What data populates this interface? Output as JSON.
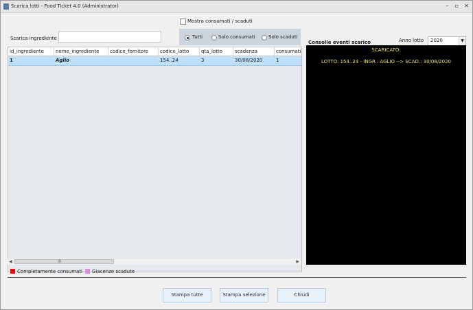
{
  "window": {
    "title": "Scarica lotti - Food Ticket 4.0   (Administrator)",
    "controls": [
      "–",
      "▫",
      "✕"
    ]
  },
  "filters": {
    "show_consumed_label": "Mostra consumati / scaduti",
    "show_consumed_checked": false,
    "search_label": "Scarica ingrediente",
    "search_value": "",
    "radio_options": [
      {
        "label": "Tutti",
        "selected": true
      },
      {
        "label": "Solo consumati",
        "selected": false
      },
      {
        "label": "Solo scaduti",
        "selected": false
      }
    ]
  },
  "table": {
    "columns": [
      "id_ingrediente",
      "nome_ingrediente",
      "codice_fornitore",
      "codice_lotto",
      "qta_lotto",
      "scadenza",
      "consumati"
    ],
    "rows": [
      [
        "1",
        "Aglio",
        "",
        "154..24",
        "3",
        "30/08/2020",
        "1"
      ]
    ],
    "scroll_grip": "III"
  },
  "legend": [
    {
      "label": "Completamente consumati",
      "color": "#e80c0c"
    },
    {
      "label": "Giacenze scadute",
      "color": "#d98ee0"
    }
  ],
  "console": {
    "title": "Consolle eventi scarico",
    "lines": [
      "SCARICATO:",
      "LOTTO: 154..24 - INGR.: AGLIO  --> SCAD.: 30/08/2020"
    ]
  },
  "year": {
    "label": "Anno lotto",
    "value": "2020"
  },
  "buttons": {
    "print_all": "Stampa tutte",
    "print_selection": "Stampa selezione",
    "close": "Chiudi"
  }
}
